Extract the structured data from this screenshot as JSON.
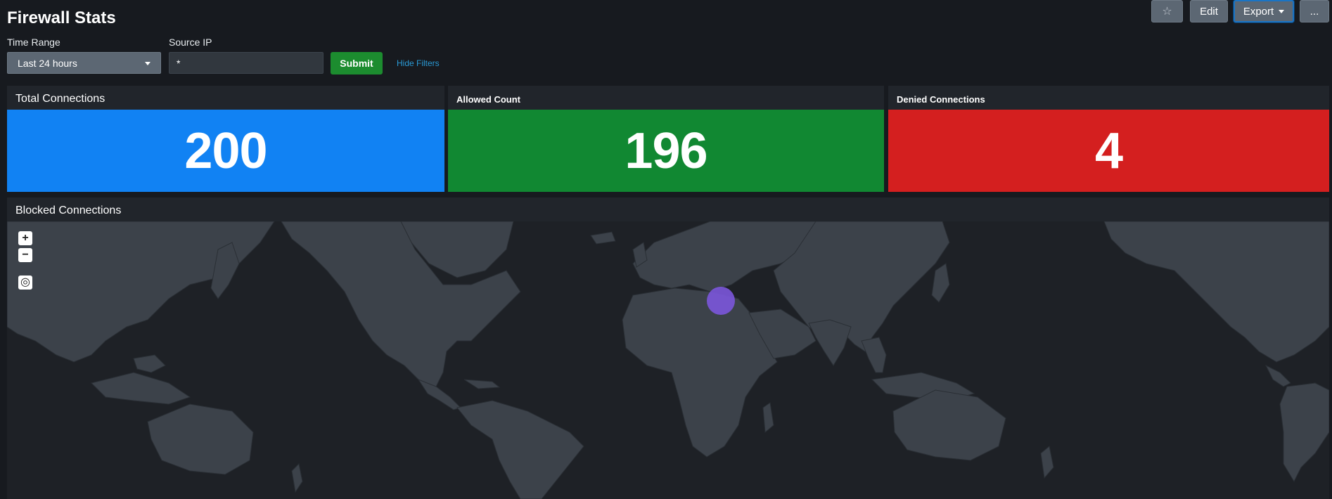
{
  "header": {
    "title": "Firewall Stats",
    "star_icon": "☆",
    "edit_label": "Edit",
    "export_label": "Export",
    "more_label": "..."
  },
  "filters": {
    "time_range_label": "Time Range",
    "time_range_value": "Last 24 hours",
    "source_ip_label": "Source IP",
    "source_ip_value": "*",
    "submit_label": "Submit",
    "hide_filters_label": "Hide Filters"
  },
  "panels": {
    "total": {
      "title": "Total Connections",
      "value": "200",
      "color": "#1182f3"
    },
    "allowed": {
      "title": "Allowed Count",
      "value": "196",
      "color": "#118832"
    },
    "denied": {
      "title": "Denied Connections",
      "value": "4",
      "color": "#d41f1f"
    }
  },
  "map_panel": {
    "title": "Blocked Connections",
    "zoom_in": "+",
    "zoom_out": "−",
    "locate_icon": "◎",
    "marker_color": "#7b56db",
    "land_color": "#3c424a"
  }
}
